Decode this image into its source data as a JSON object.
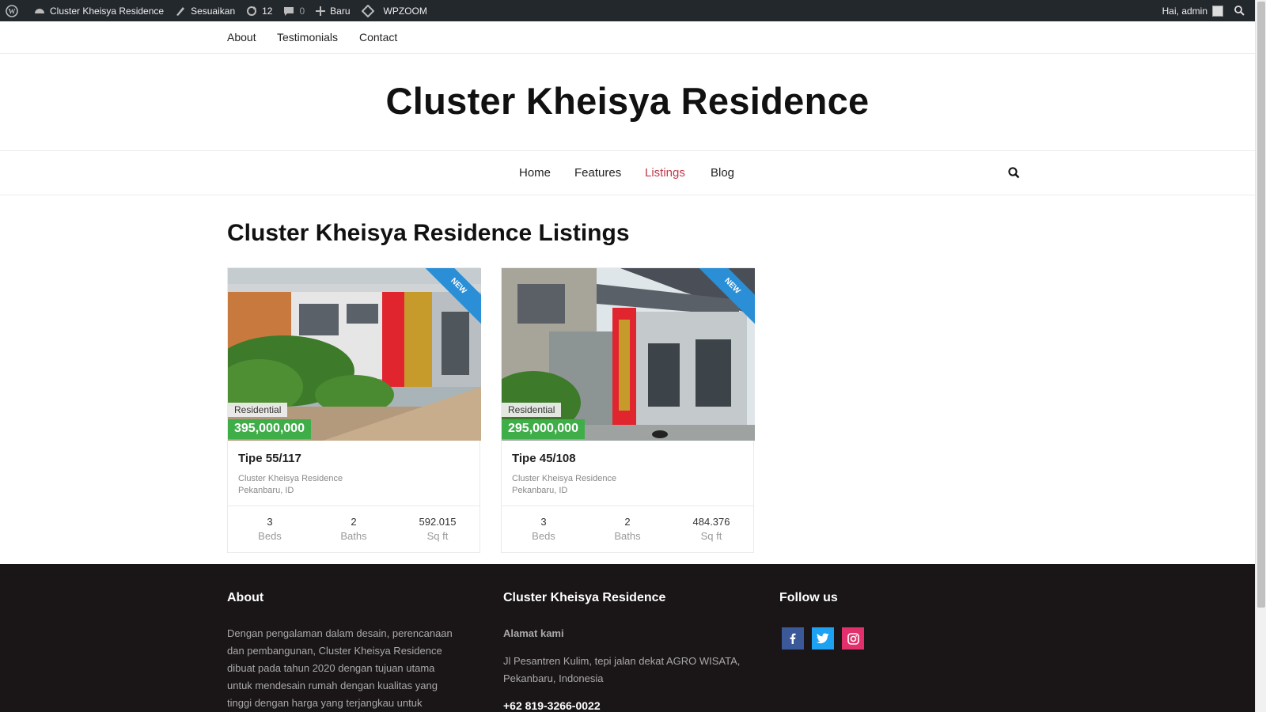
{
  "admin_bar": {
    "site_name": "Cluster Kheisya Residence",
    "customize": "Sesuaikan",
    "updates": "12",
    "comments": "0",
    "new": "Baru",
    "theme": "WPZOOM",
    "greeting": "Hai, admin"
  },
  "top_nav": [
    "About",
    "Testimonials",
    "Contact"
  ],
  "site_title": "Cluster Kheisya Residence",
  "main_nav": {
    "items": [
      "Home",
      "Features",
      "Listings",
      "Blog"
    ],
    "active": "Listings"
  },
  "page_heading": "Cluster Kheisya Residence Listings",
  "listings": [
    {
      "badge": "NEW",
      "type": "Residential",
      "price": "395,000,000",
      "title": "Tipe 55/117",
      "location_line1": "Cluster Kheisya Residence",
      "location_line2": "Pekanbaru, ID",
      "beds": "3",
      "beds_label": "Beds",
      "baths": "2",
      "baths_label": "Baths",
      "sqft": "592.015",
      "sqft_label": "Sq ft"
    },
    {
      "badge": "NEW",
      "type": "Residential",
      "price": "295,000,000",
      "title": "Tipe 45/108",
      "location_line1": "Cluster Kheisya Residence",
      "location_line2": "Pekanbaru, ID",
      "beds": "3",
      "beds_label": "Beds",
      "baths": "2",
      "baths_label": "Baths",
      "sqft": "484.376",
      "sqft_label": "Sq ft"
    }
  ],
  "footer": {
    "about_heading": "About",
    "about_lines": [
      "Dengan pengalaman dalam desain, perencanaan",
      "dan pembangunan, Cluster Kheisya Residence",
      "dibuat pada tahun 2020 dengan tujuan utama",
      "untuk mendesain rumah dengan kualitas yang",
      "tinggi dengan harga yang terjangkau untuk"
    ],
    "contact_heading": "Cluster Kheisya Residence",
    "address_label": "Alamat kami",
    "address_lines": [
      "Jl Pesantren Kulim, tepi jalan dekat AGRO WISATA,",
      "Pekanbaru, Indonesia"
    ],
    "phone": "+62 819-3266-0022",
    "follow_heading": "Follow us",
    "social": [
      "facebook",
      "twitter",
      "instagram"
    ]
  },
  "colors": {
    "accent": "#c0394a",
    "price_green": "#3fae49",
    "ribbon_blue": "#2a8fd6",
    "footer_bg": "#1a1617",
    "adminbar_bg": "#23282d",
    "facebook": "#3b5998",
    "twitter": "#1da1f2",
    "instagram": "#e1306c"
  }
}
